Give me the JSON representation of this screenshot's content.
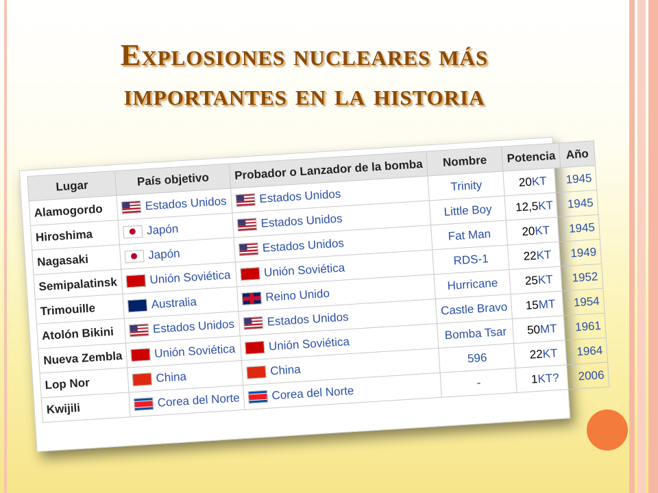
{
  "slide": {
    "title": "Explosiones nucleares más importantes en la historia"
  },
  "table": {
    "headers": [
      "Lugar",
      "País objetivo",
      "Probador o Lanzador de la bomba",
      "Nombre",
      "Potencia",
      "Año"
    ],
    "rows": [
      {
        "lugar": "Alamogordo",
        "pais": "Estados Unidos",
        "pais_flag": "us-flag-icon",
        "probador": "Estados Unidos",
        "probador_flag": "us-flag-icon",
        "nombre": "Trinity",
        "potencia_num": "20",
        "potencia_unit": "KT",
        "anio": "1945"
      },
      {
        "lugar": "Hiroshima",
        "pais": "Japón",
        "pais_flag": "japan-flag-icon",
        "probador": "Estados Unidos",
        "probador_flag": "us-flag-icon",
        "nombre": "Little Boy",
        "potencia_num": "12,5",
        "potencia_unit": "KT",
        "anio": "1945"
      },
      {
        "lugar": "Nagasaki",
        "pais": "Japón",
        "pais_flag": "japan-flag-icon",
        "probador": "Estados Unidos",
        "probador_flag": "us-flag-icon",
        "nombre": "Fat Man",
        "potencia_num": "20",
        "potencia_unit": "KT",
        "anio": "1945"
      },
      {
        "lugar": "Semipalatinsk",
        "pais": "Unión Soviética",
        "pais_flag": "ussr-flag-icon",
        "probador": "Unión Soviética",
        "probador_flag": "ussr-flag-icon",
        "nombre": "RDS-1",
        "potencia_num": "22",
        "potencia_unit": "KT",
        "anio": "1949"
      },
      {
        "lugar": "Trimouille",
        "pais": "Australia",
        "pais_flag": "australia-flag-icon",
        "probador": "Reino Unido",
        "probador_flag": "uk-flag-icon",
        "nombre": "Hurricane",
        "potencia_num": "25",
        "potencia_unit": "KT",
        "anio": "1952"
      },
      {
        "lugar": "Atolón Bikini",
        "pais": "Estados Unidos",
        "pais_flag": "us-flag-icon",
        "probador": "Estados Unidos",
        "probador_flag": "us-flag-icon",
        "nombre": "Castle Bravo",
        "potencia_num": "15",
        "potencia_unit": "MT",
        "anio": "1954"
      },
      {
        "lugar": "Nueva Zembla",
        "pais": "Unión Soviética",
        "pais_flag": "ussr-flag-icon",
        "probador": "Unión Soviética",
        "probador_flag": "ussr-flag-icon",
        "nombre": "Bomba Tsar",
        "potencia_num": "50",
        "potencia_unit": "MT",
        "anio": "1961"
      },
      {
        "lugar": "Lop Nor",
        "pais": "China",
        "pais_flag": "china-flag-icon",
        "probador": "China",
        "probador_flag": "china-flag-icon",
        "nombre": "596",
        "potencia_num": "22",
        "potencia_unit": "KT",
        "anio": "1964"
      },
      {
        "lugar": "Kwijili",
        "pais": "Corea del Norte",
        "pais_flag": "north-korea-flag-icon",
        "probador": "Corea del Norte",
        "probador_flag": "north-korea-flag-icon",
        "nombre": "-",
        "potencia_num": "1",
        "potencia_unit": "KT?",
        "anio": "2006"
      }
    ]
  },
  "colors": {
    "title": "#8a4a0a",
    "link": "#2a4fa8",
    "accent_circle": "#f37b3c",
    "border_stripe": "#f6b8a3"
  }
}
